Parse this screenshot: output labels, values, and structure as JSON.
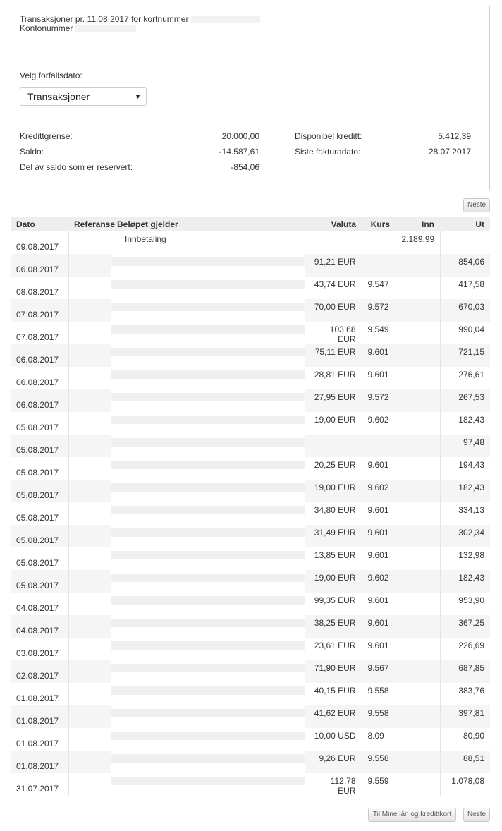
{
  "header": {
    "title_prefix": "Transaksjoner pr. 11.08.2017 for kortnummer",
    "account_label": "Kontonummer"
  },
  "due_date": {
    "label": "Velg forfallsdato:",
    "selected": "Transaksjoner"
  },
  "info_left": [
    {
      "label": "Kredittgrense:",
      "value": "20.000,00"
    },
    {
      "label": "Saldo:",
      "value": "-14.587,61"
    },
    {
      "label": "Del av saldo som er reservert:",
      "value": "-854,06"
    }
  ],
  "info_right": [
    {
      "label": "Disponibel kreditt:",
      "value": "5.412,39"
    },
    {
      "label": "Siste fakturadato:",
      "value": "28.07.2017"
    }
  ],
  "buttons": {
    "next": "Neste",
    "my_loans": "Til Mine lån og kredittkort"
  },
  "table": {
    "headers": [
      "Dato",
      "Referanse",
      "Beløpet gjelder",
      "Valuta",
      "Kurs",
      "Inn",
      "Ut"
    ],
    "rows": [
      {
        "date": "09.08.2017",
        "desc": "Innbetaling",
        "valuta": "",
        "kurs": "",
        "inn": "2.189,99",
        "ut": ""
      },
      {
        "date": "06.08.2017",
        "desc": "",
        "valuta": "91,21 EUR",
        "kurs": "",
        "inn": "",
        "ut": "854,06"
      },
      {
        "date": "08.08.2017",
        "desc": "",
        "valuta": "43,74 EUR",
        "kurs": "9.547",
        "inn": "",
        "ut": "417,58"
      },
      {
        "date": "07.08.2017",
        "desc": "",
        "valuta": "70,00 EUR",
        "kurs": "9.572",
        "inn": "",
        "ut": "670,03"
      },
      {
        "date": "07.08.2017",
        "desc": "",
        "valuta": "103,68 EUR",
        "kurs": "9.549",
        "inn": "",
        "ut": "990,04"
      },
      {
        "date": "06.08.2017",
        "desc": "",
        "valuta": "75,11 EUR",
        "kurs": "9.601",
        "inn": "",
        "ut": "721,15"
      },
      {
        "date": "06.08.2017",
        "desc": "",
        "valuta": "28,81 EUR",
        "kurs": "9.601",
        "inn": "",
        "ut": "276,61"
      },
      {
        "date": "06.08.2017",
        "desc": "",
        "valuta": "27,95 EUR",
        "kurs": "9.572",
        "inn": "",
        "ut": "267,53"
      },
      {
        "date": "05.08.2017",
        "desc": "",
        "valuta": "19,00 EUR",
        "kurs": "9.602",
        "inn": "",
        "ut": "182,43"
      },
      {
        "date": "05.08.2017",
        "desc": "",
        "valuta": "",
        "kurs": "",
        "inn": "",
        "ut": "97,48"
      },
      {
        "date": "05.08.2017",
        "desc": "",
        "valuta": "20,25 EUR",
        "kurs": "9.601",
        "inn": "",
        "ut": "194,43"
      },
      {
        "date": "05.08.2017",
        "desc": "",
        "valuta": "19,00 EUR",
        "kurs": "9.602",
        "inn": "",
        "ut": "182,43"
      },
      {
        "date": "05.08.2017",
        "desc": "",
        "valuta": "34,80 EUR",
        "kurs": "9.601",
        "inn": "",
        "ut": "334,13"
      },
      {
        "date": "05.08.2017",
        "desc": "",
        "valuta": "31,49 EUR",
        "kurs": "9.601",
        "inn": "",
        "ut": "302,34"
      },
      {
        "date": "05.08.2017",
        "desc": "",
        "valuta": "13,85 EUR",
        "kurs": "9.601",
        "inn": "",
        "ut": "132,98"
      },
      {
        "date": "05.08.2017",
        "desc": "",
        "valuta": "19,00 EUR",
        "kurs": "9.602",
        "inn": "",
        "ut": "182,43"
      },
      {
        "date": "04.08.2017",
        "desc": "",
        "valuta": "99,35 EUR",
        "kurs": "9.601",
        "inn": "",
        "ut": "953,90"
      },
      {
        "date": "04.08.2017",
        "desc": "",
        "valuta": "38,25 EUR",
        "kurs": "9.601",
        "inn": "",
        "ut": "367,25"
      },
      {
        "date": "03.08.2017",
        "desc": "",
        "valuta": "23,61 EUR",
        "kurs": "9.601",
        "inn": "",
        "ut": "226,69"
      },
      {
        "date": "02.08.2017",
        "desc": "",
        "valuta": "71,90 EUR",
        "kurs": "9.567",
        "inn": "",
        "ut": "687,85"
      },
      {
        "date": "01.08.2017",
        "desc": "",
        "valuta": "40,15 EUR",
        "kurs": "9.558",
        "inn": "",
        "ut": "383,76"
      },
      {
        "date": "01.08.2017",
        "desc": "",
        "valuta": "41,62 EUR",
        "kurs": "9.558",
        "inn": "",
        "ut": "397,81"
      },
      {
        "date": "01.08.2017",
        "desc": "",
        "valuta": "10,00 USD",
        "kurs": "8.09",
        "inn": "",
        "ut": "80,90"
      },
      {
        "date": "01.08.2017",
        "desc": "",
        "valuta": "9,26 EUR",
        "kurs": "9.558",
        "inn": "",
        "ut": "88,51"
      },
      {
        "date": "31.07.2017",
        "desc": "",
        "valuta": "112,78 EUR",
        "kurs": "9.559",
        "inn": "",
        "ut": "1.078,08"
      }
    ]
  }
}
